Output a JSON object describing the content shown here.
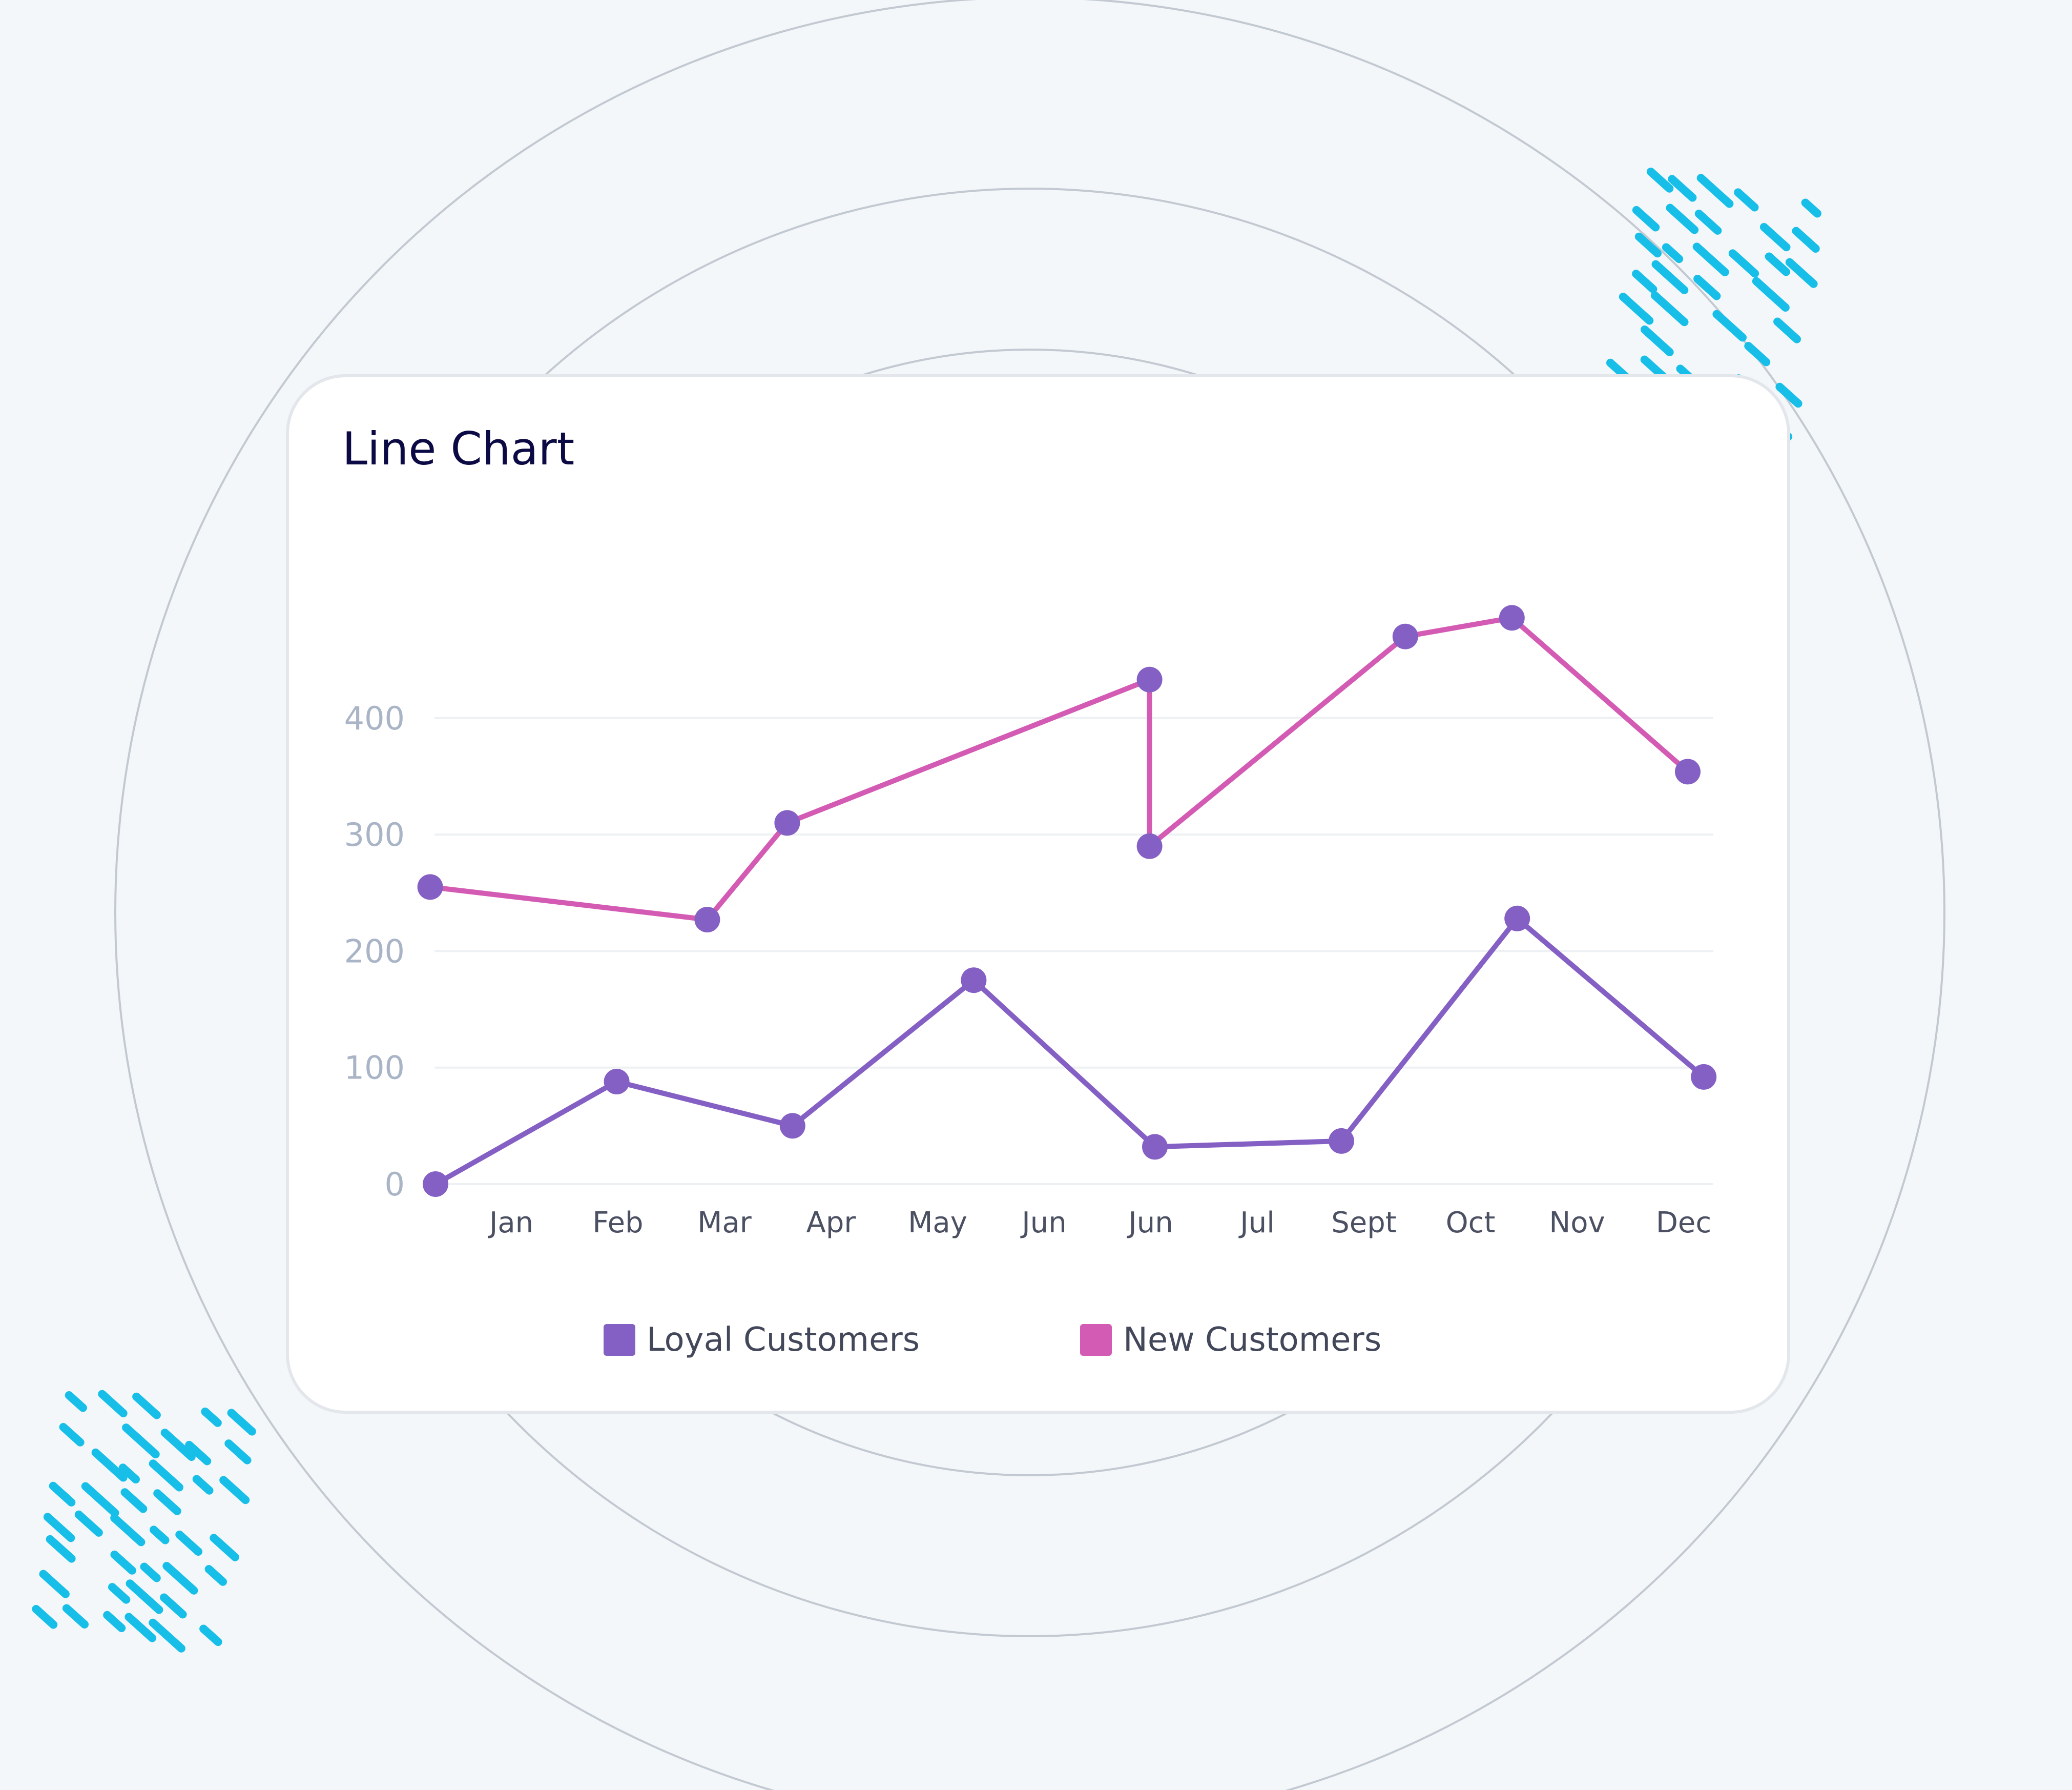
{
  "title": "Line Chart",
  "chart_data": {
    "type": "line",
    "title": "Line Chart",
    "categories": [
      "Jan",
      "Feb",
      "Mar",
      "Apr",
      "May",
      "Jun",
      "Jun",
      "Jul",
      "Sept",
      "Oct",
      "Nov",
      "Dec"
    ],
    "yticks": [
      "0",
      "100",
      "200",
      "300",
      "400"
    ],
    "ylim": [
      0,
      400
    ],
    "grid": true,
    "legend_position": "bottom",
    "series": [
      {
        "name": "Loyal Customers",
        "color": "#8560c4",
        "points": [
          {
            "x": 0.0,
            "y": 0
          },
          {
            "x": 1.7,
            "y": 88
          },
          {
            "x": 3.35,
            "y": 50
          },
          {
            "x": 5.05,
            "y": 175
          },
          {
            "x": 6.75,
            "y": 32
          },
          {
            "x": 8.5,
            "y": 37
          },
          {
            "x": 10.15,
            "y": 228
          },
          {
            "x": 11.9,
            "y": 92
          }
        ]
      },
      {
        "name": "New Customers",
        "color": "#d45bb4",
        "points": [
          {
            "x": -0.05,
            "y": 255
          },
          {
            "x": 2.55,
            "y": 227
          },
          {
            "x": 3.3,
            "y": 310
          },
          {
            "x": 6.7,
            "y": 433
          },
          {
            "x": 6.7,
            "y": 290
          },
          {
            "x": 9.1,
            "y": 470
          },
          {
            "x": 10.1,
            "y": 486
          },
          {
            "x": 11.75,
            "y": 354
          }
        ]
      }
    ]
  }
}
